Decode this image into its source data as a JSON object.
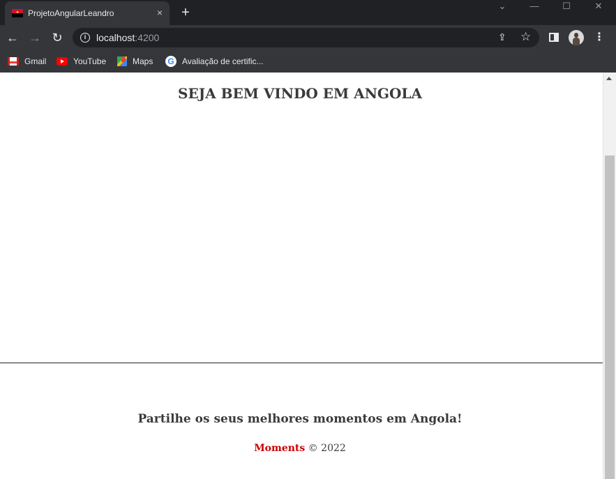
{
  "browser": {
    "tab": {
      "title": "ProjetoAngularLeandro",
      "close_icon": "×"
    },
    "new_tab_icon": "+",
    "window_controls": {
      "tab_search": "⌄",
      "minimize": "—",
      "maximize": "☐",
      "close": "✕"
    },
    "toolbar": {
      "back": "←",
      "forward": "→",
      "reload": "↻",
      "url_host": "localhost",
      "url_port": ":4200",
      "share_icon": "⇪",
      "bookmark_icon": "☆",
      "menu_icon": "⋮"
    },
    "bookmarks": [
      {
        "label": "Gmail",
        "icon": "gmail-icon"
      },
      {
        "label": "YouTube",
        "icon": "youtube-icon"
      },
      {
        "label": "Maps",
        "icon": "maps-icon"
      },
      {
        "label": "Avaliação de certific...",
        "icon": "google-icon"
      }
    ]
  },
  "page": {
    "heading": "SEJA BEM VINDO EM ANGOLA",
    "footer": {
      "tagline": "Partilhe os seus melhores momentos em Angola!",
      "brand": "Moments",
      "copyright": " © 2022"
    }
  },
  "colors": {
    "browser_dark": "#202124",
    "toolbar": "#35363a",
    "brand_red": "#cc0000",
    "text": "#3a3a3a"
  }
}
